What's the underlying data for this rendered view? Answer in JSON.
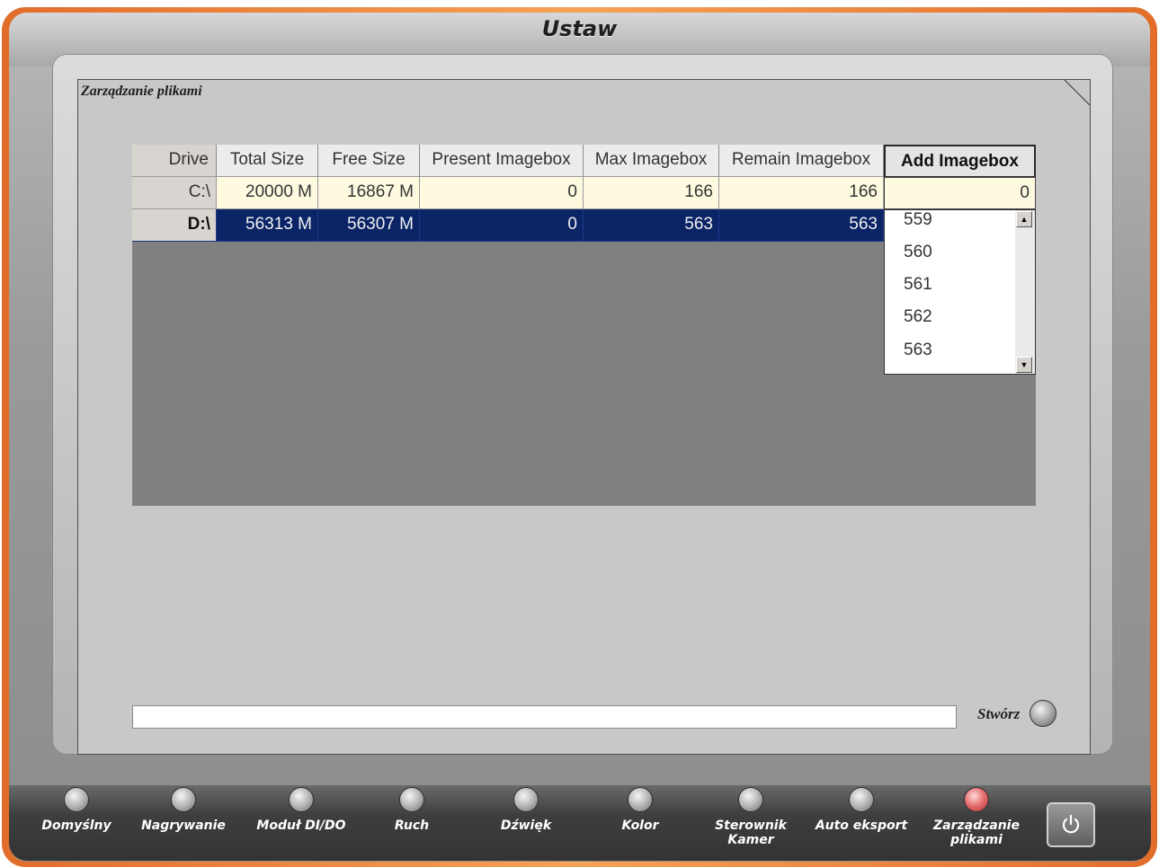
{
  "window": {
    "title": "Ustaw"
  },
  "panel": {
    "title": "Zarządzanie plikami"
  },
  "table": {
    "headers": [
      "Drive",
      "Total Size",
      "Free Size",
      "Present Imagebox",
      "Max Imagebox",
      "Remain Imagebox",
      "Add Imagebox"
    ],
    "rows": [
      [
        "C:\\",
        "20000 M",
        "16867 M",
        "0",
        "166",
        "166",
        "0"
      ],
      [
        "D:\\",
        "56313 M",
        "56307 M",
        "0",
        "563",
        "563",
        ""
      ]
    ]
  },
  "dropdown": {
    "options": [
      "559",
      "560",
      "561",
      "562",
      "563"
    ]
  },
  "footer": {
    "input_value": "",
    "create_label": "Stwórz"
  },
  "nav": {
    "items": [
      {
        "label": "Domyślny"
      },
      {
        "label": "Nagrywanie"
      },
      {
        "label": "Moduł DI/DO"
      },
      {
        "label": "Ruch"
      },
      {
        "label": "Dźwięk"
      },
      {
        "label": "Kolor"
      },
      {
        "label": "Sterownik Kamer"
      },
      {
        "label": "Auto eksport"
      },
      {
        "label": "Zarządzanie plikami"
      }
    ],
    "active": "Zarządzanie plikami"
  },
  "icons": {
    "power": "power-icon"
  },
  "colors": {
    "frame": "#f08a3e",
    "selected_row": "#0a2466",
    "editable_row": "#fefae0",
    "active_nav": "#e46a6a"
  }
}
